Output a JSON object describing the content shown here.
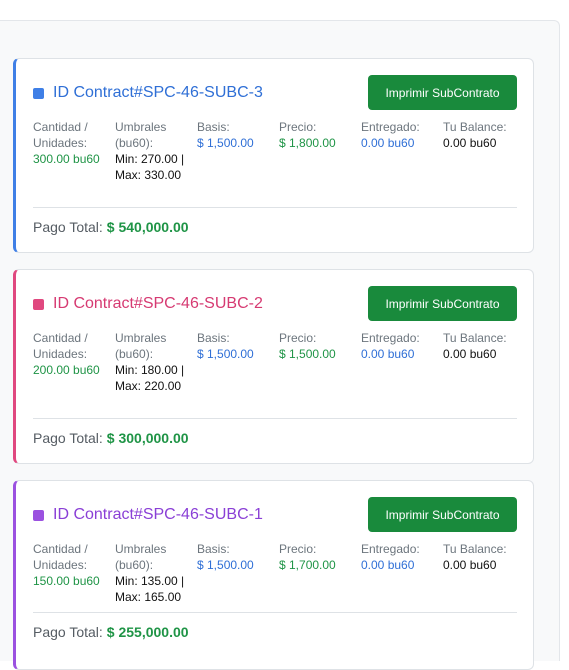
{
  "button_label": "Imprimir SubContrato",
  "labels": {
    "cantidad": "Cantidad / Unidades:",
    "umbrales": "Umbrales (bu60):",
    "basis": "Basis:",
    "precio": "Precio:",
    "entregado": "Entregado:",
    "balance": "Tu Balance:",
    "pago_total": "Pago Total:"
  },
  "colors": {
    "card1_accent": "#3f7fe6",
    "card2_accent": "#e0487f",
    "card3_accent": "#9b51e0",
    "button": "#198a3c",
    "money_green": "#1f9446",
    "value_blue": "#2f6fd6"
  },
  "cards": [
    {
      "title": "ID Contract#SPC-46-SUBC-3",
      "cantidad": "300.00 bu60",
      "umbrales": "Min: 270.00 | Max: 330.00",
      "basis": "$ 1,500.00",
      "precio": "$ 1,800.00",
      "entregado": "0.00 bu60",
      "balance": "0.00 bu60",
      "pago_total": "$ 540,000.00"
    },
    {
      "title": "ID Contract#SPC-46-SUBC-2",
      "cantidad": "200.00 bu60",
      "umbrales": "Min: 180.00 | Max: 220.00",
      "basis": "$ 1,500.00",
      "precio": "$ 1,500.00",
      "entregado": "0.00 bu60",
      "balance": "0.00 bu60",
      "pago_total": "$ 300,000.00"
    },
    {
      "title": "ID Contract#SPC-46-SUBC-1",
      "cantidad": "150.00 bu60",
      "umbrales": "Min: 135.00 | Max: 165.00",
      "basis": "$ 1,500.00",
      "precio": "$ 1,700.00",
      "entregado": "0.00 bu60",
      "balance": "0.00 bu60",
      "pago_total": "$ 255,000.00"
    }
  ]
}
